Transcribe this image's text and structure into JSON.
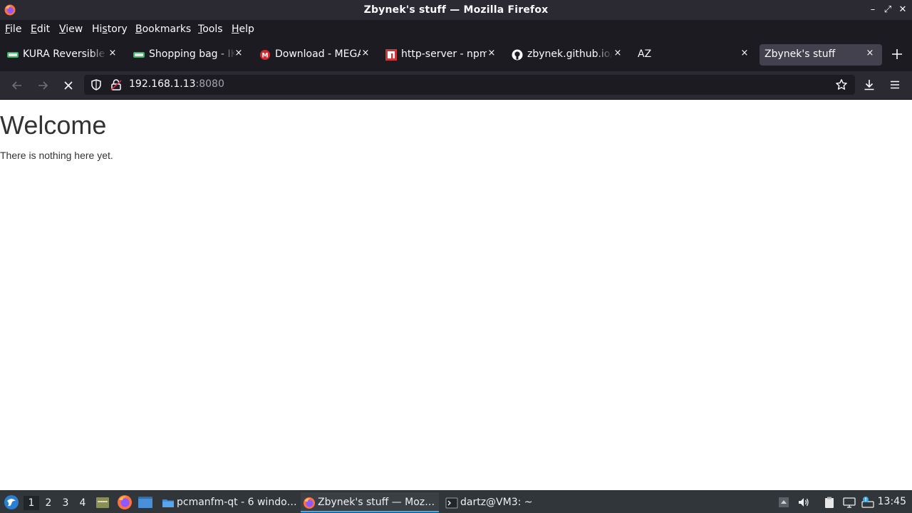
{
  "window": {
    "title": "Zbynek's stuff — Mozilla Firefox",
    "controls": {
      "minimize": "–",
      "maximize": "⤢",
      "close": "✕"
    }
  },
  "menubar": {
    "items": [
      {
        "label": "File",
        "accel": "F",
        "rest": "ile"
      },
      {
        "label": "Edit",
        "accel": "E",
        "rest": "dit"
      },
      {
        "label": "View",
        "accel": "V",
        "rest": "iew"
      },
      {
        "label": "History",
        "pre": "Hi",
        "accel": "s",
        "rest": "tory"
      },
      {
        "label": "Bookmarks",
        "accel": "B",
        "rest": "ookmarks"
      },
      {
        "label": "Tools",
        "accel": "T",
        "rest": "ools"
      },
      {
        "label": "Help",
        "accel": "H",
        "rest": "elp"
      }
    ]
  },
  "tabs": [
    {
      "label": "KURA Reversible b",
      "icon": "ikea-favicon-icon"
    },
    {
      "label": "Shopping bag - IKI",
      "icon": "ikea-favicon-icon"
    },
    {
      "label": "Download - MEGA",
      "icon": "mega-favicon-icon"
    },
    {
      "label": "http-server - npm",
      "icon": "npm-favicon-icon"
    },
    {
      "label": "zbynek.github.io/a",
      "icon": "github-favicon-icon"
    },
    {
      "label": "AZ",
      "icon": ""
    },
    {
      "label": "Zbynek's stuff",
      "icon": "",
      "active": true
    }
  ],
  "tab_close": "×",
  "navbar": {
    "url_host": "192.168.1.13",
    "url_port": ":8080"
  },
  "page": {
    "heading": "Welcome",
    "body": "There is nothing here yet."
  },
  "taskbar": {
    "desktops": [
      "1",
      "2",
      "3",
      "4"
    ],
    "active_desktop": "1",
    "tasks": [
      {
        "label": "pcmanfm-qt - 6 windo…",
        "icon": "folder-icon"
      },
      {
        "label": "Zbynek's stuff — Moz…",
        "icon": "firefox-icon",
        "active": true
      },
      {
        "label": "dartz@VM3: ~",
        "icon": "terminal-icon"
      }
    ],
    "clock": "13:45"
  },
  "colors": {
    "titlebar": "#2b2a33",
    "tabstrip": "#1c1b22",
    "active_tab": "#42414d",
    "taskbar": "#31363b",
    "accent": "#3daee9"
  }
}
